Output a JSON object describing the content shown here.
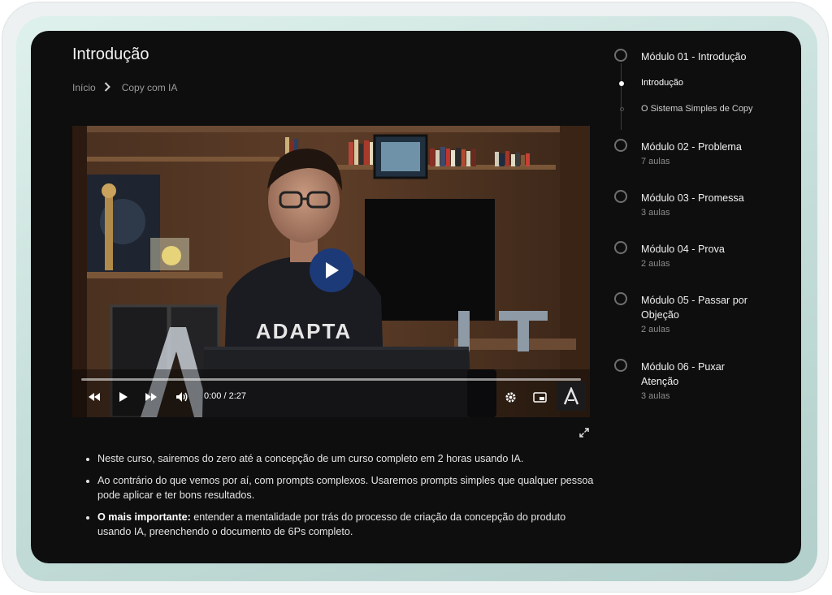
{
  "page": {
    "title": "Introdução",
    "breadcrumb": {
      "home": "Início",
      "current": "Copy com IA"
    }
  },
  "video": {
    "time": "0:00 / 2:27",
    "progress": 0,
    "shirt_text": "ADAPTA"
  },
  "description": {
    "items": [
      {
        "bold": "",
        "text": "Neste curso, sairemos do zero até a concepção de um curso completo em 2 horas usando IA."
      },
      {
        "bold": "",
        "text": "Ao contrário do que vemos por aí, com prompts complexos. Usaremos prompts simples que qualquer pessoa pode aplicar e ter bons resultados."
      },
      {
        "bold": "O mais importante:",
        "text": " entender a mentalidade por trás do processo de criação da concepção do produto usando IA, preenchendo o documento de 6Ps completo."
      }
    ]
  },
  "sidebar": {
    "modules": [
      {
        "title": "Módulo 01 - Introdução",
        "subtitle": "",
        "lessons": [
          {
            "label": "Introdução",
            "active": true
          },
          {
            "label": "O Sistema Simples de Copy",
            "active": false
          }
        ]
      },
      {
        "title": "Módulo 02 - Problema",
        "subtitle": "7 aulas"
      },
      {
        "title": "Módulo 03 - Promessa",
        "subtitle": "3 aulas"
      },
      {
        "title": "Módulo 04 - Prova",
        "subtitle": "2 aulas"
      },
      {
        "title": "Módulo 05 - Passar por Objeção",
        "subtitle": "2 aulas"
      },
      {
        "title": "Módulo 06 - Puxar Atenção",
        "subtitle": "3 aulas"
      }
    ]
  },
  "colors": {
    "screen_bg": "#0e0e0f",
    "play_button": "#1d3a78",
    "bezel": "#c8e0dc"
  }
}
